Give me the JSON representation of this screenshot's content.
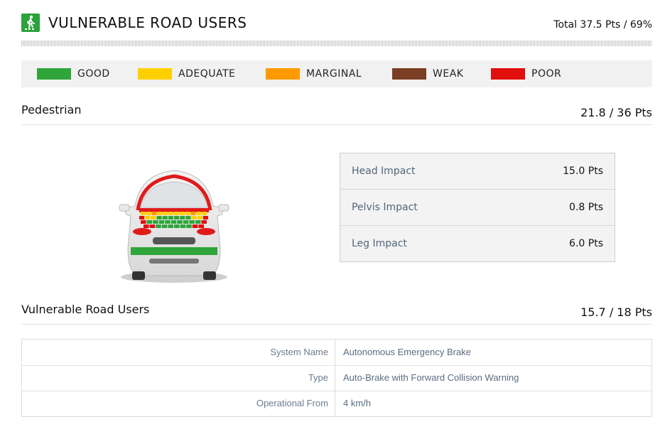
{
  "header": {
    "title": "VULNERABLE ROAD USERS",
    "total": "Total 37.5 Pts / 69%",
    "icon": "pedestrian-crossing-icon"
  },
  "legend": [
    {
      "label": "GOOD",
      "color": "#2fa53a"
    },
    {
      "label": "ADEQUATE",
      "color": "#ffd000"
    },
    {
      "label": "MARGINAL",
      "color": "#ff9a00"
    },
    {
      "label": "WEAK",
      "color": "#7b3e22"
    },
    {
      "label": "POOR",
      "color": "#e10e0e"
    }
  ],
  "pedestrian": {
    "name": "Pedestrian",
    "score": "21.8 / 36 Pts",
    "rows": [
      {
        "label": "Head Impact",
        "value": "15.0 Pts"
      },
      {
        "label": "Pelvis Impact",
        "value": "0.8 Pts"
      },
      {
        "label": "Leg Impact",
        "value": "6.0 Pts"
      }
    ]
  },
  "vru": {
    "name": "Vulnerable Road Users",
    "score": "15.7 / 18 Pts",
    "rows": [
      {
        "label": "System Name",
        "value": "Autonomous Emergency Brake"
      },
      {
        "label": "Type",
        "value": "Auto-Brake with Forward Collision Warning"
      },
      {
        "label": "Operational From",
        "value": "4 km/h"
      }
    ]
  }
}
